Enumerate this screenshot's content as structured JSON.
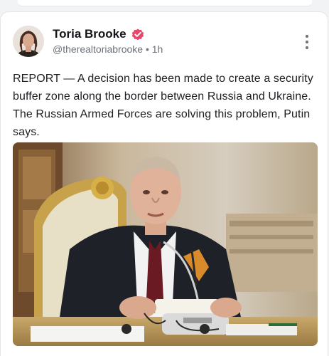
{
  "post": {
    "author": {
      "display_name": "Toria Brooke",
      "handle": "@therealtoriabrooke",
      "separator": "•",
      "time_ago": "1h",
      "verified": true,
      "verified_icon": "verified-badge-icon",
      "verified_color": "#e8456b"
    },
    "menu_icon": "more-vertical-icon",
    "text": "REPORT — A decision has been made to create a security buffer zone along the border between Russia and Ukraine. The Russian Armed Forces are solving this problem, Putin says.",
    "image": {
      "description_icon": "news-photo"
    }
  },
  "theme": {
    "text_primary": "#111418",
    "text_secondary": "#6b7079",
    "card_background": "#ffffff",
    "page_background": "#f2f3f5"
  }
}
